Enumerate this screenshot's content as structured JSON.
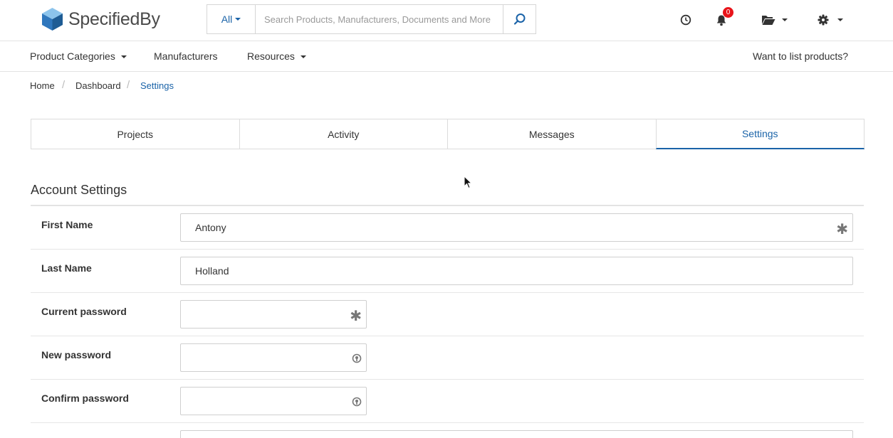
{
  "header": {
    "brand": "SpecifiedBy",
    "search": {
      "category": "All",
      "placeholder": "Search Products, Manufacturers, Documents and More",
      "value": ""
    },
    "notifications_count": "0"
  },
  "nav": {
    "product_categories": "Product Categories",
    "manufacturers": "Manufacturers",
    "resources": "Resources",
    "list_products": "Want to list products?"
  },
  "breadcrumb": {
    "home": "Home",
    "dashboard": "Dashboard",
    "current": "Settings",
    "separator": "/"
  },
  "tabs": [
    {
      "label": "Projects",
      "active": false
    },
    {
      "label": "Activity",
      "active": false
    },
    {
      "label": "Messages",
      "active": false
    },
    {
      "label": "Settings",
      "active": true
    }
  ],
  "account_settings": {
    "title": "Account Settings",
    "fields": [
      {
        "label": "First Name",
        "value": "Antony"
      },
      {
        "label": "Last Name",
        "value": "Holland"
      },
      {
        "label": "Current password",
        "value": ""
      },
      {
        "label": "New password",
        "value": ""
      },
      {
        "label": "Confirm password",
        "value": ""
      }
    ]
  },
  "colors": {
    "accent": "#1a63a8",
    "badge": "#e8141a",
    "logo_dark": "#1e5c94",
    "logo_light": "#5aa0d8"
  }
}
